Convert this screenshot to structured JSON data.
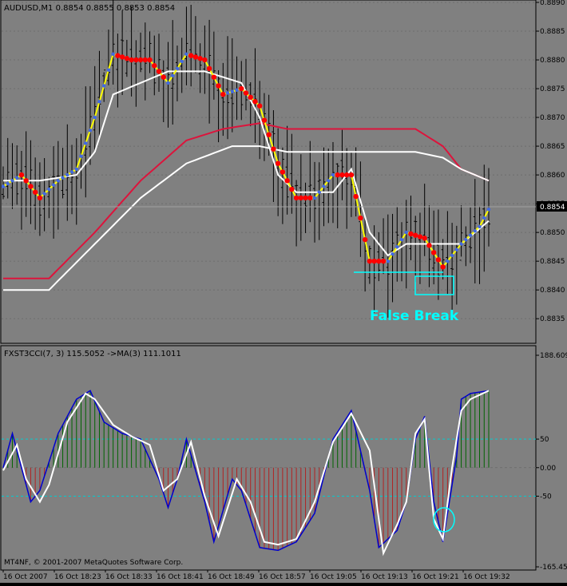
{
  "price_panel": {
    "header": "AUDUSD,M1  0.8854 0.8855 0.8853 0.8854",
    "current_price": "0.8854",
    "annotation": "False Break",
    "y_axis_labels": [
      "0.8890",
      "0.8885",
      "0.8880",
      "0.8875",
      "0.8870",
      "0.8865",
      "0.8860",
      "0.8855",
      "0.8850",
      "0.8845",
      "0.8840",
      "0.8835"
    ]
  },
  "indicator_panel": {
    "header": "FXST3CCI(7, 3) 115.5052  ->MA(3) 111.1011",
    "y_axis_labels": [
      "188.6093",
      "50",
      "0.00",
      "-50",
      "-165.4556"
    ],
    "copyright": "MT4NF, © 2001-2007 MetaQuotes Software Corp."
  },
  "x_axis_labels": [
    "16 Oct 2007",
    "16 Oct 18:23",
    "16 Oct 18:33",
    "16 Oct 18:41",
    "16 Oct 18:49",
    "16 Oct 18:57",
    "16 Oct 19:05",
    "16 Oct 19:13",
    "16 Oct 19:21",
    "16 Oct 19:32"
  ],
  "colors": {
    "panel_bg": "#808080",
    "frame": "#000000",
    "text": "#000000",
    "grid": "#6e6e6e",
    "bar": "#000000",
    "signal_line": "#FFFF00",
    "up_dot": "#4169E1",
    "down_dot": "#FF0000",
    "slow_ma": "#DC143C",
    "envelope": "#FFFFFF",
    "annotation": "#00FFFF",
    "cci_line": "#0000CD",
    "ma_line": "#FFFFFF",
    "hist_pos": "#006400",
    "hist_neg": "#B22222",
    "level_line": "#00CED1",
    "price_tag_bg": "#000000",
    "price_tag_text": "#FFFFFF"
  },
  "chart_data": [
    {
      "type": "line",
      "symbol": "AUDUSD",
      "timeframe": "M1",
      "ylim": [
        0.8831,
        0.889
      ],
      "bars_count": 107,
      "series": [
        {
          "role": "signal",
          "x": [
            0,
            4,
            8,
            12,
            16,
            20,
            24,
            28,
            32,
            36,
            40,
            44,
            48,
            52,
            56,
            60,
            64,
            68,
            72,
            76,
            80,
            84,
            88,
            92,
            96,
            100,
            104,
            106
          ],
          "y": [
            0.8858,
            0.886,
            0.8856,
            0.8859,
            0.8861,
            0.887,
            0.8881,
            0.888,
            0.888,
            0.8876,
            0.8881,
            0.888,
            0.8874,
            0.8875,
            0.8872,
            0.8862,
            0.8856,
            0.8856,
            0.886,
            0.886,
            0.8845,
            0.8845,
            0.885,
            0.8849,
            0.8844,
            0.8848,
            0.8851,
            0.8854
          ]
        },
        {
          "role": "envelope-fast",
          "x": [
            0,
            8,
            16,
            20,
            24,
            36,
            44,
            52,
            56,
            60,
            64,
            72,
            76,
            80,
            84,
            88,
            96,
            100,
            106
          ],
          "y": [
            0.8859,
            0.8859,
            0.886,
            0.8864,
            0.8874,
            0.8878,
            0.8878,
            0.8876,
            0.887,
            0.886,
            0.8857,
            0.8857,
            0.8861,
            0.885,
            0.8846,
            0.8848,
            0.8848,
            0.8848,
            0.8852
          ]
        },
        {
          "role": "envelope-slow",
          "x": [
            0,
            10,
            20,
            30,
            40,
            50,
            56,
            62,
            70,
            80,
            90,
            96,
            100,
            106
          ],
          "y": [
            0.884,
            0.884,
            0.8848,
            0.8856,
            0.8862,
            0.8865,
            0.8865,
            0.8864,
            0.8864,
            0.8864,
            0.8864,
            0.8863,
            0.8861,
            0.8859
          ]
        },
        {
          "role": "slow-ma",
          "x": [
            0,
            10,
            20,
            30,
            40,
            48,
            56,
            62,
            70,
            80,
            90,
            96,
            100,
            106
          ],
          "y": [
            0.8842,
            0.8842,
            0.885,
            0.8859,
            0.8866,
            0.8868,
            0.8869,
            0.8868,
            0.8868,
            0.8868,
            0.8868,
            0.8865,
            0.8861,
            0.8859
          ]
        }
      ]
    },
    {
      "type": "line",
      "ylim": [
        -165.4556,
        188.6093
      ],
      "levels": [
        50,
        0,
        -50
      ],
      "series": [
        {
          "role": "cci",
          "x": [
            0,
            2,
            3,
            6,
            8,
            12,
            16,
            19,
            22,
            26,
            30,
            34,
            36,
            38,
            40,
            44,
            46,
            50,
            52,
            56,
            60,
            64,
            68,
            72,
            76,
            78,
            80,
            82,
            86,
            88,
            90,
            92,
            94,
            96,
            99,
            100,
            102,
            106
          ],
          "y": [
            0,
            60,
            30,
            -60,
            -40,
            60,
            120,
            135,
            80,
            60,
            50,
            -20,
            -70,
            -20,
            50,
            -60,
            -130,
            -20,
            -40,
            -140,
            -145,
            -130,
            -80,
            50,
            100,
            30,
            -40,
            -140,
            -110,
            -60,
            50,
            90,
            -60,
            -130,
            20,
            120,
            130,
            135
          ]
        },
        {
          "role": "ma",
          "x": [
            0,
            3,
            5,
            8,
            10,
            14,
            18,
            20,
            24,
            28,
            32,
            35,
            38,
            41,
            44,
            47,
            51,
            54,
            57,
            60,
            64,
            68,
            72,
            76,
            80,
            83,
            86,
            88,
            90,
            92,
            94,
            96,
            98,
            100,
            102,
            106
          ],
          "y": [
            -5,
            40,
            -20,
            -60,
            -30,
            80,
            130,
            120,
            75,
            55,
            40,
            -40,
            -20,
            45,
            -50,
            -120,
            -20,
            -60,
            -130,
            -135,
            -125,
            -60,
            45,
            95,
            30,
            -150,
            -100,
            -60,
            60,
            85,
            -90,
            -125,
            0,
            100,
            120,
            135
          ]
        }
      ]
    }
  ]
}
